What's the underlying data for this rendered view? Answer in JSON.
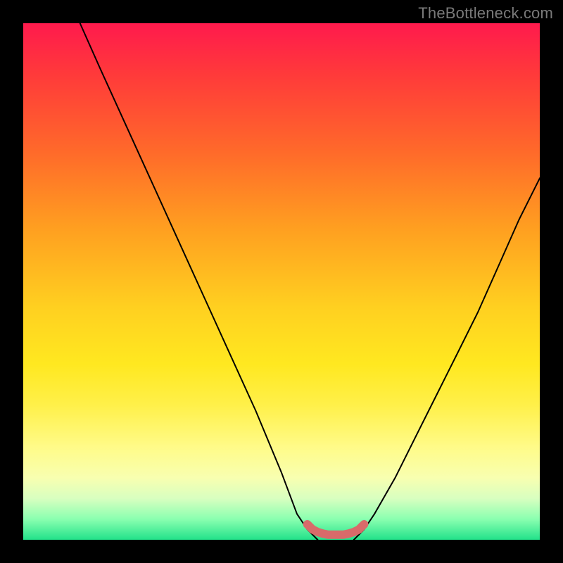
{
  "watermark": "TheBottleneck.com",
  "chart_data": {
    "type": "line",
    "title": "",
    "xlabel": "",
    "ylabel": "",
    "xlim": [
      0,
      100
    ],
    "ylim": [
      0,
      100
    ],
    "grid": false,
    "left_curve": {
      "x": [
        11,
        15,
        20,
        25,
        30,
        35,
        40,
        45,
        50,
        53,
        55,
        57
      ],
      "y": [
        100,
        91,
        80,
        69,
        58,
        47,
        36,
        25,
        13,
        5,
        2,
        0
      ]
    },
    "right_curve": {
      "x": [
        64,
        66,
        68,
        72,
        76,
        80,
        84,
        88,
        92,
        96,
        100
      ],
      "y": [
        0,
        2,
        5,
        12,
        20,
        28,
        36,
        44,
        53,
        62,
        70
      ]
    },
    "valley_marker": {
      "x": [
        55,
        56,
        57,
        58,
        59,
        60,
        61,
        62,
        63,
        64,
        65,
        66
      ],
      "y": [
        3,
        2,
        1.5,
        1.2,
        1,
        1,
        1,
        1,
        1.2,
        1.5,
        2,
        3
      ]
    },
    "colors": {
      "curve": "#000000",
      "valley": "#d86a6a"
    }
  }
}
